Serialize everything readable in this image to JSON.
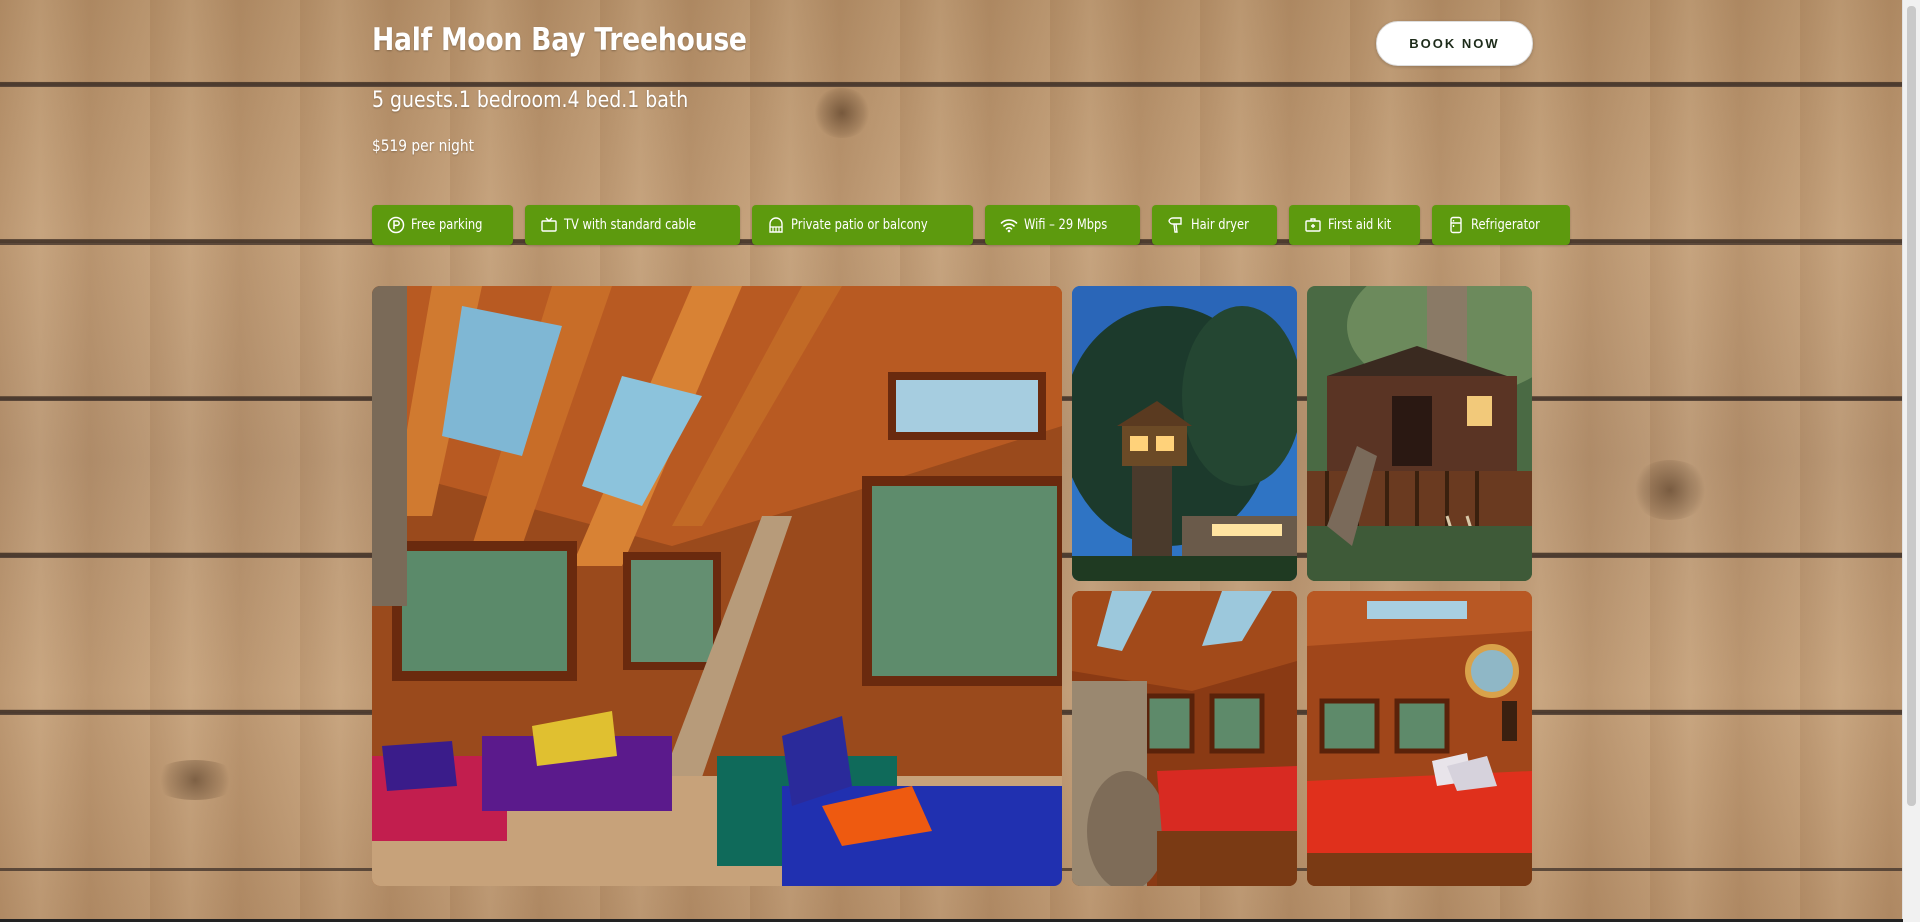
{
  "listing": {
    "title": "Half Moon Bay Treehouse",
    "summary": "5 guests.1 bedroom.4 bed.1 bath",
    "price": "$519 per night"
  },
  "header": {
    "book_label": "BOOK NOW"
  },
  "amenities": [
    {
      "label": "Free parking",
      "icon": "parking-icon"
    },
    {
      "label": "TV with standard cable",
      "icon": "tv-icon"
    },
    {
      "label": "Private patio or balcony",
      "icon": "patio-icon"
    },
    {
      "label": "Wifi – 29 Mbps",
      "icon": "wifi-icon"
    },
    {
      "label": "Hair dryer",
      "icon": "hair-dryer-icon"
    },
    {
      "label": "First aid kit",
      "icon": "first-aid-icon"
    },
    {
      "label": "Refrigerator",
      "icon": "refrigerator-icon"
    }
  ],
  "gallery": {
    "photos": [
      "main-interior-photo",
      "treehouse-night-photo",
      "treehouse-deck-photo",
      "bedroom-skylight-photo",
      "bedroom-porthole-photo"
    ]
  },
  "colors": {
    "accent": "#5d9a0e",
    "button_bg": "#ffffff",
    "text": "#ffffff"
  }
}
